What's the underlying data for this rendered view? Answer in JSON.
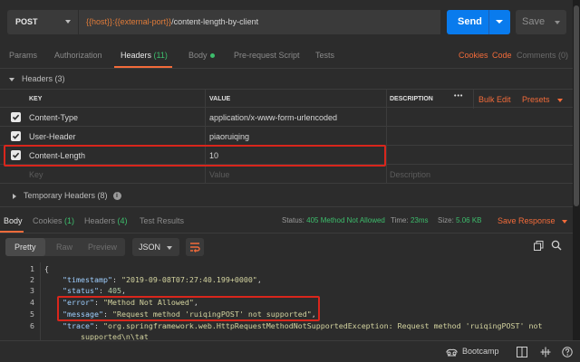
{
  "request": {
    "method": "POST",
    "url_parts": [
      "{{host}}",
      ":",
      "{{external-port}}",
      "/content-length-by-client"
    ],
    "send_label": "Send",
    "save_label": "Save"
  },
  "request_tabs": [
    {
      "label": "Params"
    },
    {
      "label": "Authorization"
    },
    {
      "label": "Headers",
      "count": "(11)"
    },
    {
      "label": "Body"
    },
    {
      "label": "Pre-request Script"
    },
    {
      "label": "Tests"
    }
  ],
  "request_links": {
    "cookies": "Cookies",
    "code": "Code",
    "comments": "Comments (0)"
  },
  "headers_section": {
    "title": "Headers (3)",
    "columns": {
      "key": "KEY",
      "value": "VALUE",
      "description": "DESCRIPTION"
    },
    "more": "•••",
    "bulk_edit": "Bulk Edit",
    "presets": "Presets",
    "rows": [
      {
        "key": "Content-Type",
        "value": "application/x-www-form-urlencoded",
        "checked": true
      },
      {
        "key": "User-Header",
        "value": "piaoruiqing",
        "checked": true
      },
      {
        "key": "Content-Length",
        "value": "10",
        "checked": true
      }
    ],
    "placeholders": {
      "key": "Key",
      "value": "Value",
      "description": "Description"
    }
  },
  "temporary_headers": "Temporary Headers (8)",
  "response_tabs": [
    {
      "label": "Body"
    },
    {
      "label": "Cookies",
      "count": "(1)"
    },
    {
      "label": "Headers",
      "count": "(4)"
    },
    {
      "label": "Test Results"
    }
  ],
  "response_status": {
    "status_label": "Status:",
    "status_value": "405 Method Not Allowed",
    "time_label": "Time:",
    "time_value": "23ms",
    "size_label": "Size:",
    "size_value": "5.06 KB",
    "save_response": "Save Response"
  },
  "view_modes": [
    "Pretty",
    "Raw",
    "Preview"
  ],
  "format": "JSON",
  "code_lines": [
    {
      "n": "1",
      "text": "{"
    },
    {
      "n": "2",
      "key": "\"timestamp\"",
      "val": "\"2019-09-08T07:27:40.199+0000\"",
      "tail": ","
    },
    {
      "n": "3",
      "key": "\"status\"",
      "val": "405",
      "tail": ","
    },
    {
      "n": "4",
      "key": "\"error\"",
      "val": "\"Method Not Allowed\"",
      "tail": ","
    },
    {
      "n": "5",
      "key": "\"message\"",
      "val": "\"Request method 'ruiqingPOST' not supported\"",
      "tail": ","
    },
    {
      "n": "6",
      "key": "\"trace\"",
      "val": "\"org.springframework.web.HttpRequestMethodNotSupportedException: Request method 'ruiqingPOST' not",
      "tail": ""
    },
    {
      "n": "",
      "text": "    supported\\n\\tat"
    }
  ],
  "footer": {
    "bootcamp": "Bootcamp"
  },
  "colors": {
    "accent": "#f26b3a",
    "send": "#097bed",
    "highlight": "#d9261c",
    "success": "#3dbd6c"
  }
}
